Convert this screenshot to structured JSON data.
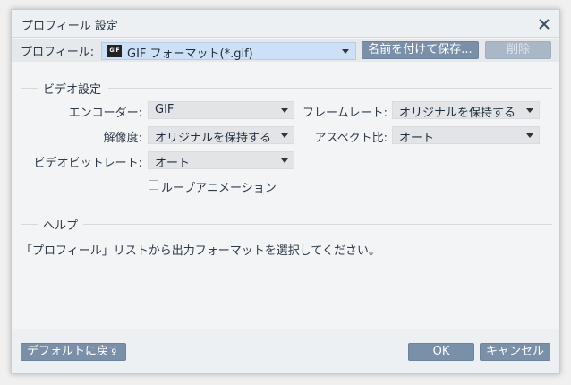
{
  "window": {
    "title": "プロフィール 設定"
  },
  "profile": {
    "label": "プロフィール:",
    "value": "GIF フォーマット(*.gif)",
    "icon_text": "GIF",
    "save_as_label": "名前を付けて保存...",
    "delete_label": "削除"
  },
  "video": {
    "section_title": "ビデオ設定",
    "encoder": {
      "label": "エンコーダー:",
      "value": "GIF"
    },
    "frame_rate": {
      "label": "フレームレート:",
      "value": "オリジナルを保持する"
    },
    "resolution": {
      "label": "解像度:",
      "value": "オリジナルを保持する"
    },
    "aspect_ratio": {
      "label": "アスペクト比:",
      "value": "オート"
    },
    "bitrate": {
      "label": "ビデオビットレート:",
      "value": "オート"
    },
    "loop_animation": {
      "label": "ループアニメーション",
      "checked": false
    }
  },
  "help": {
    "section_title": "ヘルプ",
    "text": "「プロフィール」リストから出力フォーマットを選択してください。"
  },
  "footer": {
    "reset_label": "デフォルトに戻す",
    "ok_label": "OK",
    "cancel_label": "キャンセル"
  },
  "colors": {
    "button": "#7a90a8",
    "button_disabled": "#a9b7c6",
    "selected_profile_bg": "#cde0f5",
    "combo_bg": "#e2e4e7"
  }
}
